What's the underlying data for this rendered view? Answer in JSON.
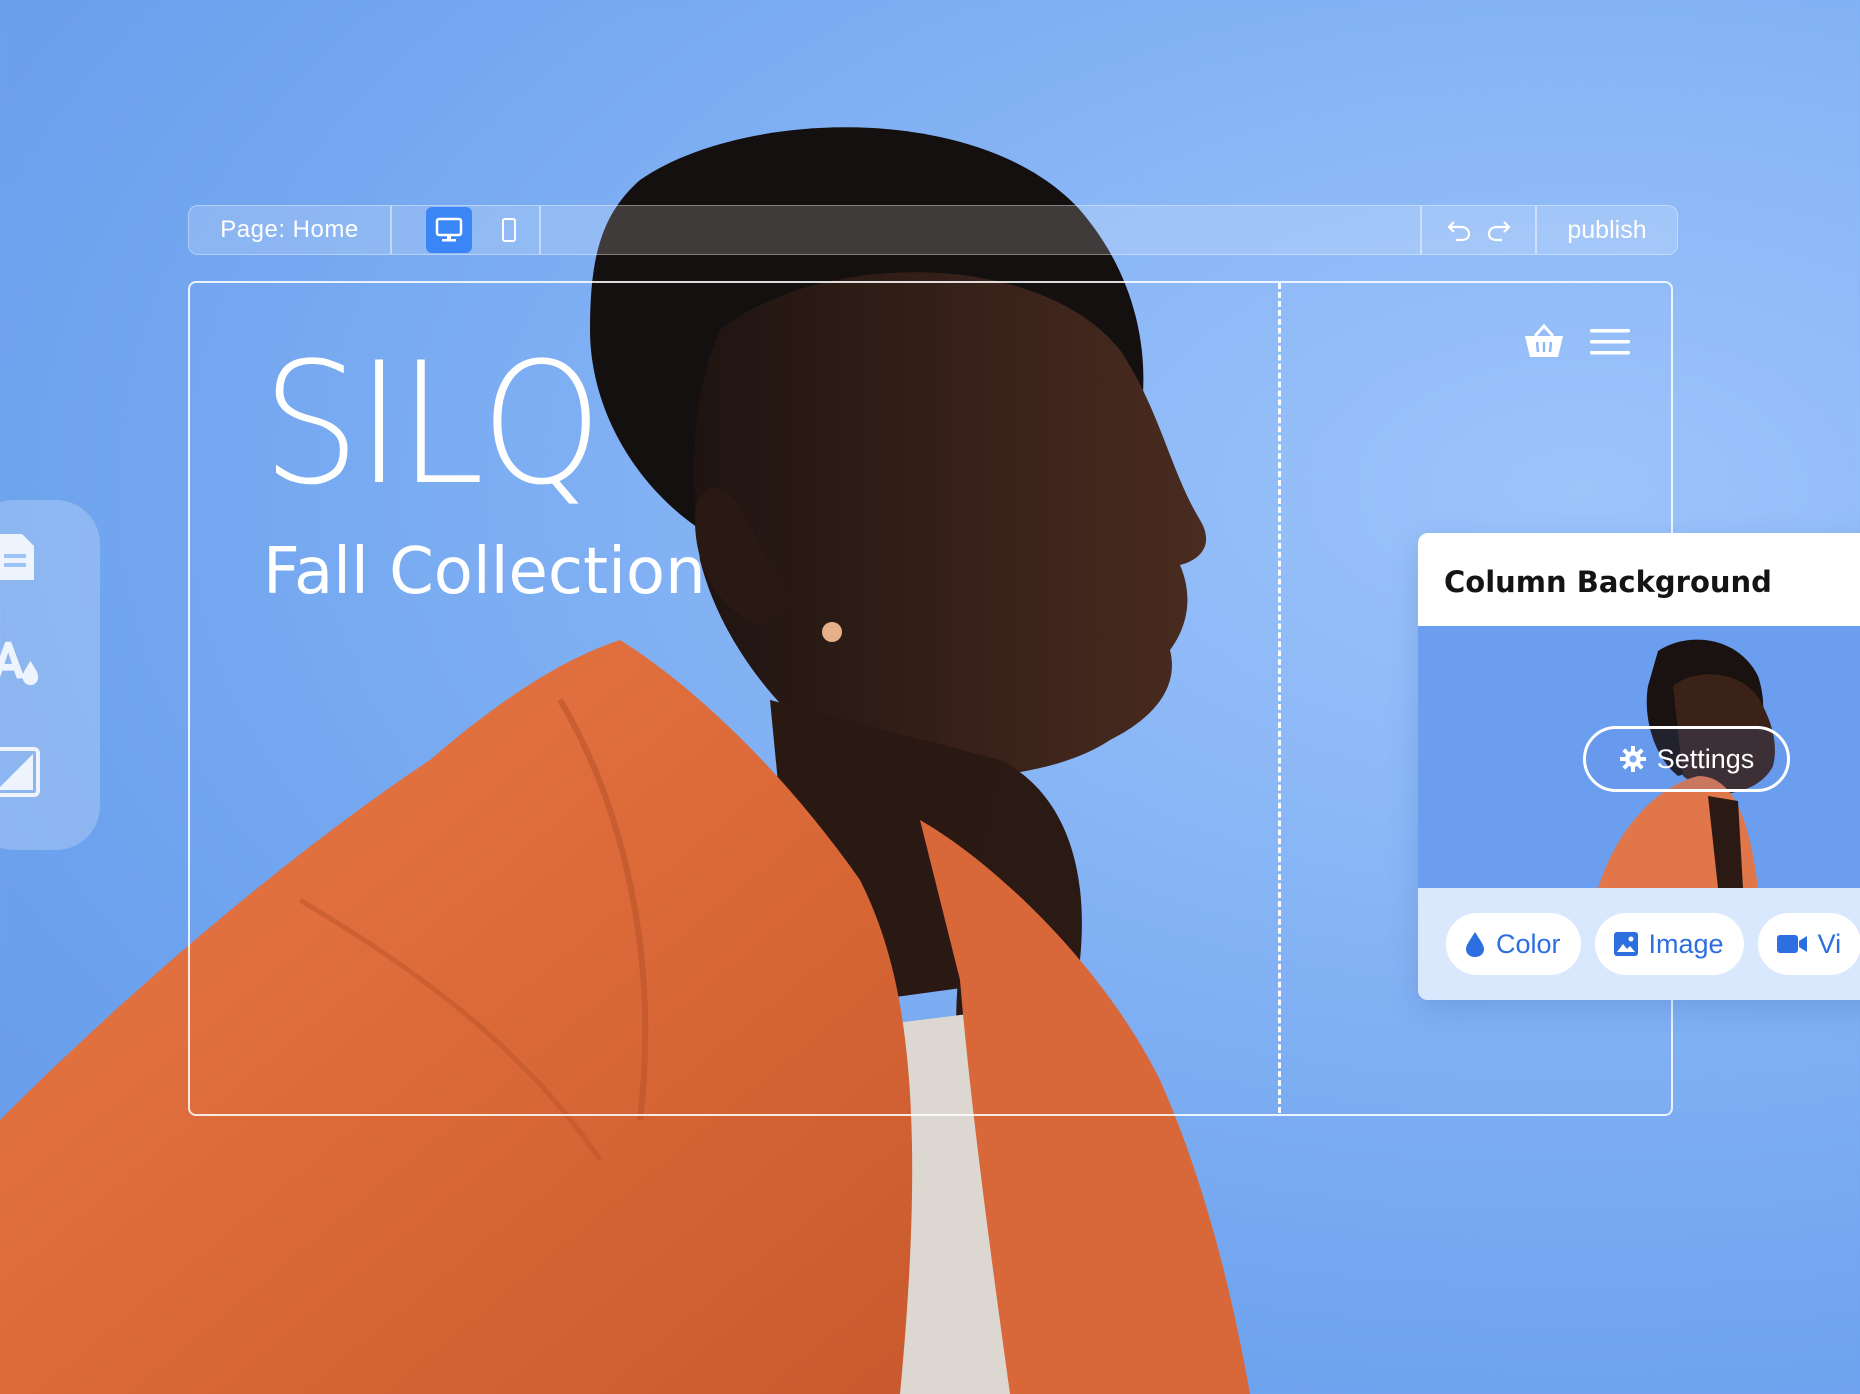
{
  "toolbar": {
    "page_label": "Page: Home",
    "publish_label": "publish",
    "desktop_icon": "desktop-icon",
    "mobile_icon": "mobile-icon",
    "undo_icon": "undo-icon",
    "redo_icon": "redo-icon"
  },
  "site": {
    "logo": "SILQ",
    "subtitle": "Fall Collection",
    "cart_icon": "basket-icon",
    "menu_icon": "hamburger-icon"
  },
  "side_tools": [
    {
      "icon": "page-icon"
    },
    {
      "icon": "text-color-icon"
    },
    {
      "icon": "background-icon"
    }
  ],
  "panel": {
    "title": "Column Background",
    "settings_label": "Settings",
    "options": [
      {
        "label": "Color",
        "icon": "drop-icon"
      },
      {
        "label": "Image",
        "icon": "image-icon"
      },
      {
        "label": "Vi",
        "icon": "video-icon"
      }
    ]
  },
  "colors": {
    "background": "#86b4f5",
    "accent": "#3b86f6",
    "jacket": "#e26f3f",
    "option_text": "#2d6ee0"
  }
}
